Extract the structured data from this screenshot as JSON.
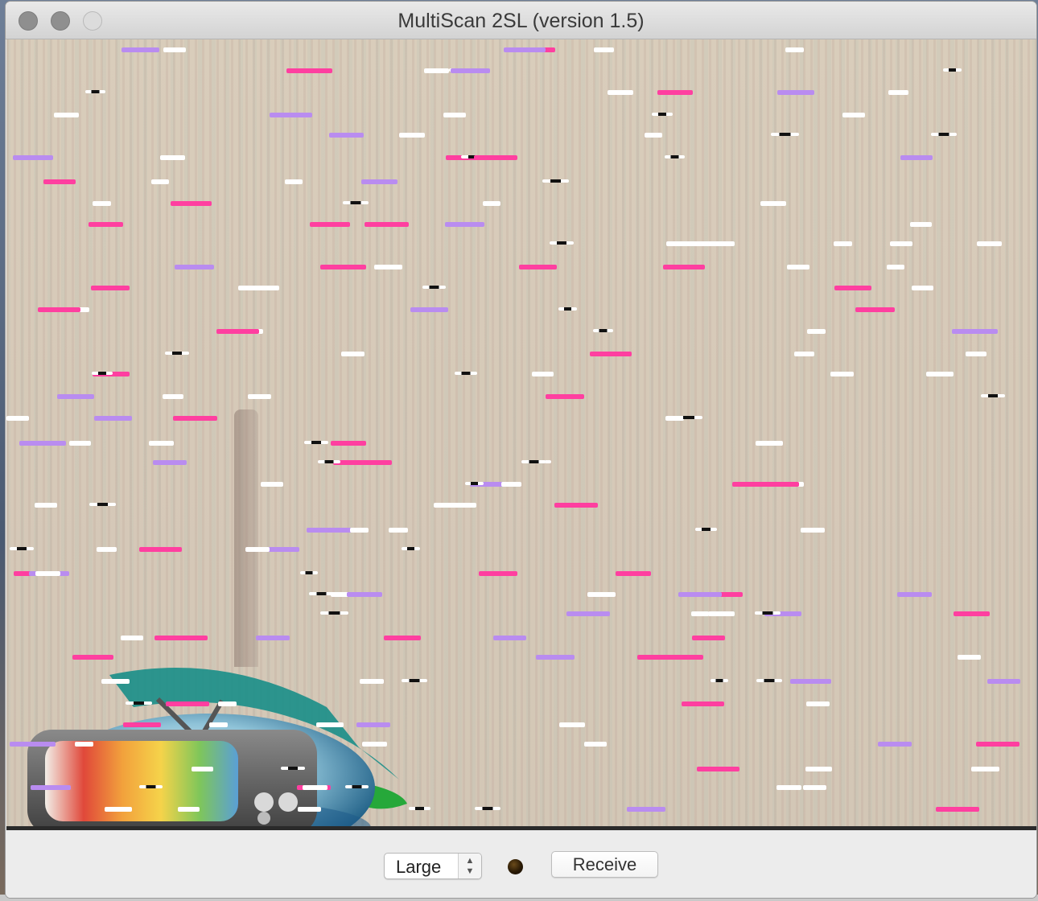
{
  "window": {
    "title": "MultiScan 2SL (version 1.5)"
  },
  "controls": {
    "size_select": {
      "value": "Large"
    },
    "receive_label": "Receive"
  },
  "colors": {
    "noise_pink": "#ff3fa0",
    "noise_violet": "#b98cf0",
    "noise_white": "#ffffff",
    "noise_black": "#111111",
    "status_indicator": "#3a2408"
  },
  "icons": {
    "close": "close-icon",
    "minimize": "minimize-icon",
    "zoom": "zoom-icon",
    "stepper": "chevron-up-down-icon",
    "logo": "multiscan-tv-logo"
  }
}
